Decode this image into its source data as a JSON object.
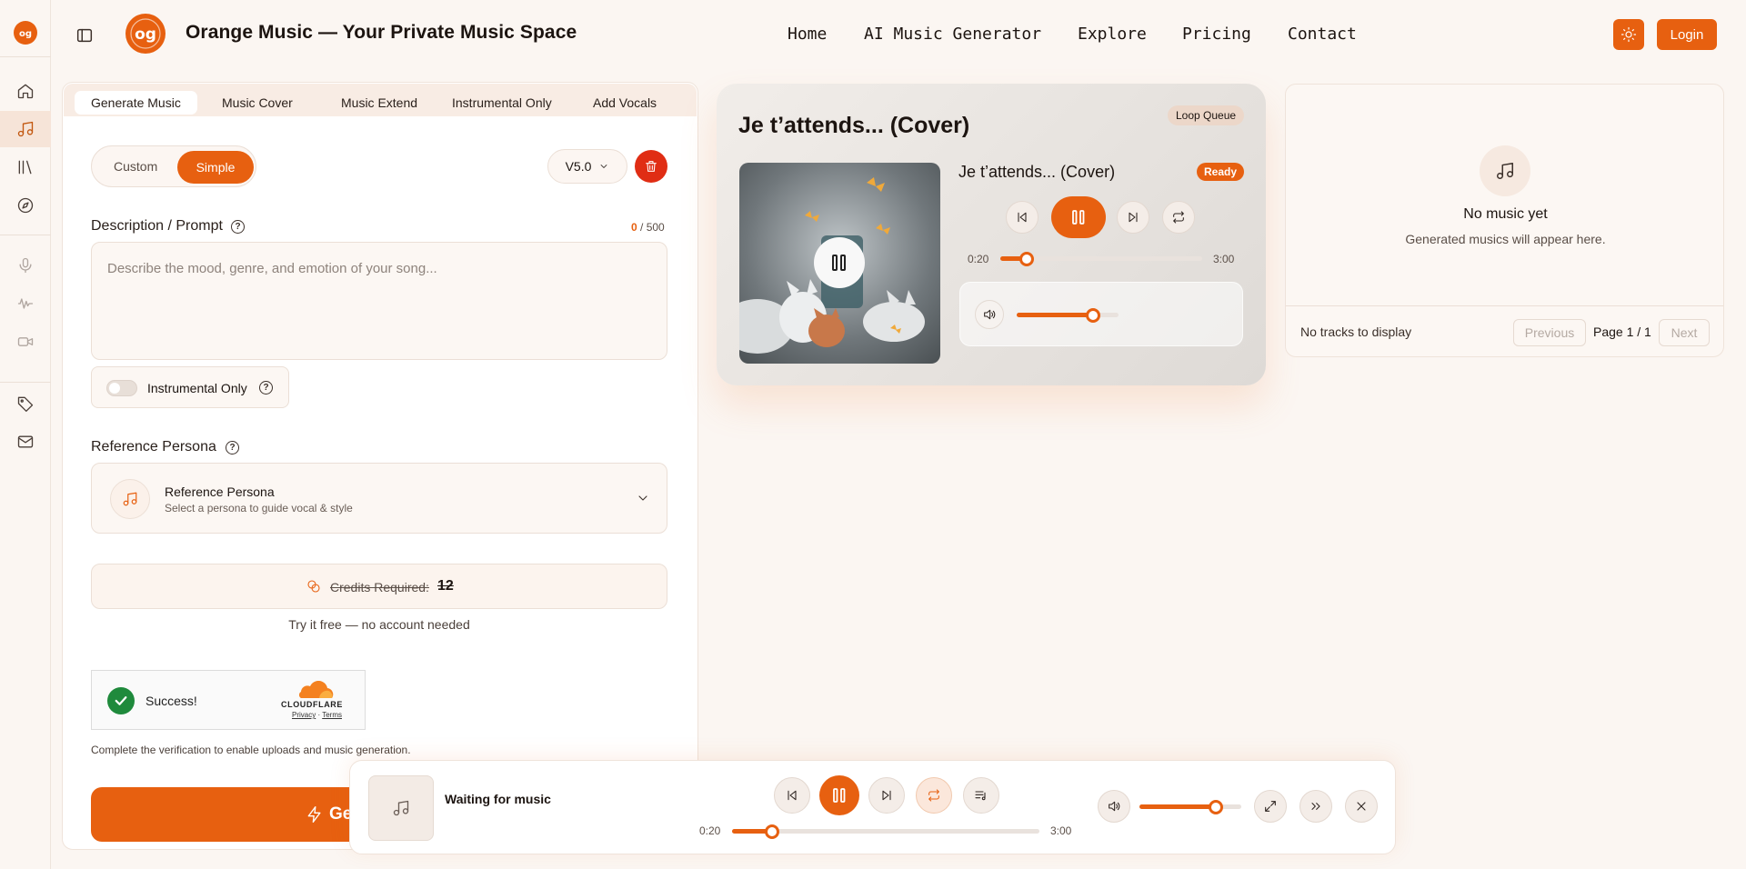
{
  "header": {
    "title": "Orange Music — Your Private Music Space",
    "nav": [
      "Home",
      "AI Music Generator",
      "Explore",
      "Pricing",
      "Contact"
    ],
    "login_label": "Login"
  },
  "generator": {
    "tabs": [
      "Generate Music",
      "Music Cover",
      "Music Extend",
      "Instrumental Only",
      "Add Vocals"
    ],
    "mode_custom": "Custom",
    "mode_simple": "Simple",
    "version": "V5.0",
    "description_label": "Description / Prompt",
    "char_count": "0",
    "char_max": "/ 500",
    "prompt_placeholder": "Describe the mood, genre, and emotion of your song...",
    "instrumental_label": "Instrumental Only",
    "persona_label": "Reference Persona",
    "persona_title": "Reference Persona",
    "persona_subtitle": "Select a persona to guide vocal & style",
    "credits_label": "Credits Required:",
    "credits_value": "12",
    "try_free": "Try it free — no account needed",
    "captcha_status": "Success!",
    "captcha_brand": "CLOUDFLARE",
    "captcha_privacy": "Privacy",
    "captcha_sep": "·",
    "captcha_terms": "Terms",
    "verify_note": "Complete the verification to enable uploads and music generation.",
    "generate_label": "Ge"
  },
  "player_card": {
    "title": "Je t’attends... (Cover)",
    "loop_badge": "Loop Queue",
    "track_title": "Je t’attends... (Cover)",
    "status_badge": "Ready",
    "time_current": "0:20",
    "time_total": "3:00",
    "progress": 0.13,
    "volume": 0.75
  },
  "library": {
    "empty_title": "No music yet",
    "empty_subtitle": "Generated musics will appear here.",
    "no_tracks": "No tracks to display",
    "prev_label": "Previous",
    "page_label": "Page 1 / 1",
    "next_label": "Next"
  },
  "bottom_player": {
    "status": "Waiting for music",
    "time_current": "0:20",
    "time_total": "3:00",
    "progress": 0.13,
    "volume": 0.75
  },
  "colors": {
    "accent": "#e76010",
    "delete": "#e02d14",
    "background": "#fbf6f2"
  }
}
